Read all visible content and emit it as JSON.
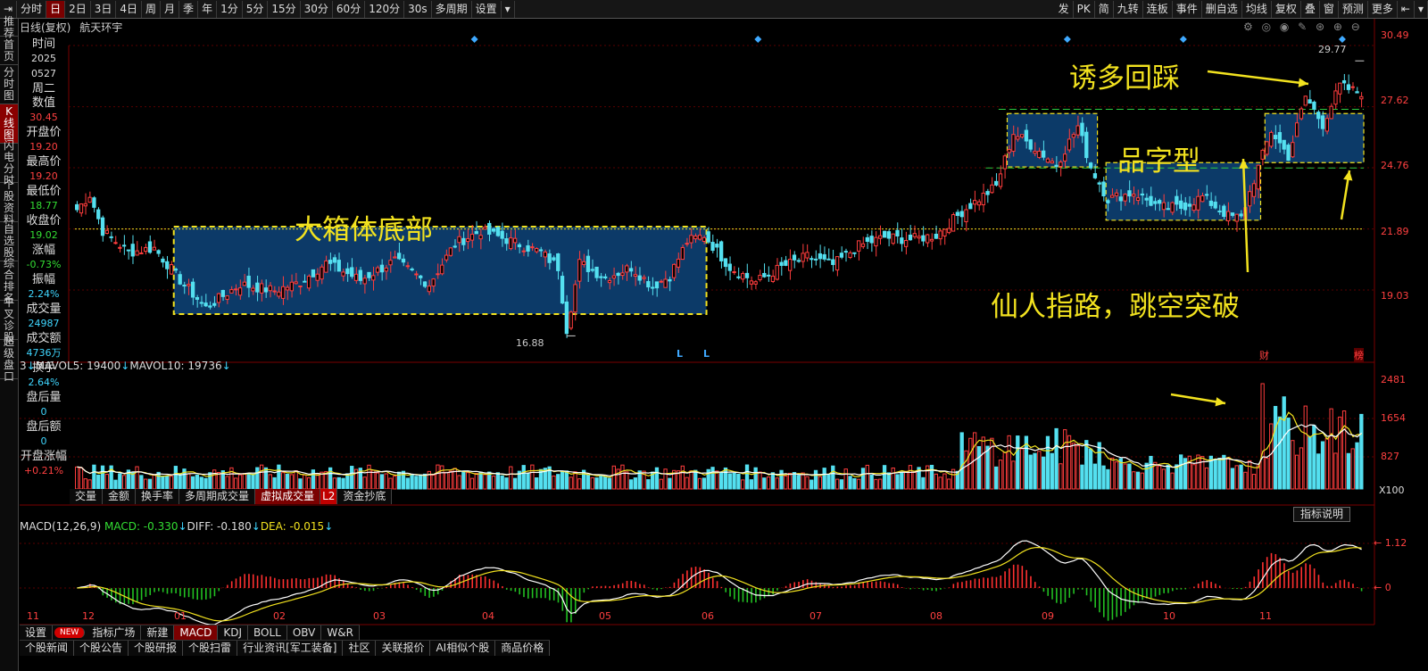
{
  "toolbar": {
    "items": [
      "分时",
      "日",
      "2日",
      "3日",
      "4日",
      "周",
      "月",
      "季",
      "年",
      "1分",
      "5分",
      "15分",
      "30分",
      "60分",
      "120分",
      "30s",
      "多周期",
      "设置"
    ],
    "active": "日",
    "right": [
      "发",
      "PK",
      "简",
      "九转",
      "连板",
      "事件",
      "删自选",
      "均线",
      "复权",
      "叠",
      "窗",
      "预测",
      "更多"
    ]
  },
  "sidebar": [
    {
      "label": "推荐",
      "active": false
    },
    {
      "label": "首页",
      "active": false
    },
    {
      "label": "分时图",
      "active": false
    },
    {
      "label": "K线图",
      "active": true
    },
    {
      "label": "闪电分时",
      "active": false
    },
    {
      "label": "个股资料",
      "active": false
    },
    {
      "label": "自选股",
      "active": false
    },
    {
      "label": "综合排名",
      "active": false
    },
    {
      "label": "牛叉诊股",
      "active": false
    },
    {
      "label": "超级盘口",
      "active": false
    }
  ],
  "stock": {
    "period_label": "日线(复权)",
    "name": "航天环宇"
  },
  "info": [
    {
      "label": "时间",
      "value": "2025",
      "color": "wht"
    },
    {
      "label": "",
      "value": "0527",
      "color": "wht"
    },
    {
      "label": "周二",
      "value": "",
      "color": "wht"
    },
    {
      "label": "数值",
      "value": "30.45",
      "color": "red"
    },
    {
      "label": "开盘价",
      "value": "19.20",
      "color": "red"
    },
    {
      "label": "最高价",
      "value": "19.20",
      "color": "red"
    },
    {
      "label": "最低价",
      "value": "18.77",
      "color": "grn"
    },
    {
      "label": "收盘价",
      "value": "19.02",
      "color": "grn"
    },
    {
      "label": "涨幅",
      "value": "-0.73%",
      "color": "grn"
    },
    {
      "label": "振幅",
      "value": "2.24%",
      "color": "cyan"
    },
    {
      "label": "成交量",
      "value": "24987",
      "color": "cyan"
    },
    {
      "label": "成交额",
      "value": "4736万",
      "color": "cyan"
    },
    {
      "label": "换手",
      "value": "2.64%",
      "color": "cyan"
    },
    {
      "label": "盘后量",
      "value": "0",
      "color": "cyan"
    },
    {
      "label": "盘后额",
      "value": "0",
      "color": "cyan"
    },
    {
      "label": "开盘涨幅",
      "value": "+0.21%",
      "color": "red"
    }
  ],
  "price_axis": {
    "ticks": [
      "30.49",
      "27.62",
      "24.76",
      "21.89",
      "19.03"
    ]
  },
  "max_label": "29.77",
  "min_label": "16.88",
  "markers": {
    "L1": "L",
    "L2": "L",
    "cai": "财",
    "bang": "榜"
  },
  "vol_legend": {
    "mavol5": "MAVOL5: 19400",
    "mavol10": "MAVOL10: 19736",
    "prefix": "3"
  },
  "vol_axis": {
    "ticks": [
      "2481",
      "1654",
      "827"
    ],
    "unit": "X100"
  },
  "vol_tabs": [
    "交量",
    "金额",
    "换手率",
    "多周期成交量",
    "虚拟成交量",
    "L2",
    "资金抄底"
  ],
  "vol_tab_active": "虚拟成交量",
  "macd_legend": {
    "name": "MACD(12,26,9)",
    "macd": "MACD: -0.330",
    "diff": "DIFF: -0.180",
    "dea": "DEA: -0.015"
  },
  "macd_axis": {
    "ticks": [
      "1.12",
      "0"
    ]
  },
  "explain_btn": "指标说明",
  "x_months": [
    "11",
    "12",
    "01",
    "02",
    "03",
    "04",
    "05",
    "06",
    "07",
    "08",
    "09",
    "10",
    "11"
  ],
  "ind_tabs": [
    "设置",
    "NEW",
    "指标广场",
    "新建",
    "MACD",
    "KDJ",
    "BOLL",
    "OBV",
    "W&R"
  ],
  "ind_tab_active": "MACD",
  "news_tabs": [
    "个股新闻",
    "个股公告",
    "个股研报",
    "个股扫雷",
    "行业资讯[军工装备]",
    "社区",
    "关联报价",
    "AI相似个股",
    "商品价格"
  ],
  "annotations": {
    "box_big": "大箱体底部",
    "pin": "品字型",
    "lure": "诱多回踩",
    "gap": "仙人指路，跳空突破"
  },
  "colors": {
    "up": "#ff3d3d",
    "down": "#54e0f0",
    "box_fill": "#0c3a68",
    "annotation": "#f2e21f",
    "background": "#000000"
  },
  "chart_data": {
    "type": "candlestick",
    "title": "航天环宇 日线(复权)",
    "ylim": [
      16.5,
      30.49
    ],
    "anchors": [
      [
        0,
        22.8
      ],
      [
        3,
        23.5
      ],
      [
        6,
        21.8
      ],
      [
        12,
        20.8
      ],
      [
        18,
        21.0
      ],
      [
        24,
        19.5
      ],
      [
        30,
        18.2
      ],
      [
        38,
        19.3
      ],
      [
        46,
        19.0
      ],
      [
        52,
        19.4
      ],
      [
        58,
        20.3
      ],
      [
        66,
        19.5
      ],
      [
        74,
        20.4
      ],
      [
        82,
        19.3
      ],
      [
        88,
        21.2
      ],
      [
        94,
        21.8
      ],
      [
        100,
        21.4
      ],
      [
        108,
        20.8
      ],
      [
        112,
        20.1
      ],
      [
        114,
        17.2
      ],
      [
        117,
        20.3
      ],
      [
        123,
        19.6
      ],
      [
        129,
        20.1
      ],
      [
        134,
        19.2
      ],
      [
        138,
        19.7
      ],
      [
        142,
        21.3
      ],
      [
        146,
        21.6
      ],
      [
        152,
        20.1
      ],
      [
        158,
        19.4
      ],
      [
        164,
        20.1
      ],
      [
        170,
        20.6
      ],
      [
        176,
        20.2
      ],
      [
        182,
        21.1
      ],
      [
        188,
        21.5
      ],
      [
        194,
        21.4
      ],
      [
        200,
        21.6
      ],
      [
        206,
        22.7
      ],
      [
        214,
        23.9
      ],
      [
        218,
        26.4
      ],
      [
        223,
        25.7
      ],
      [
        228,
        24.9
      ],
      [
        233,
        26.7
      ],
      [
        236,
        24.8
      ],
      [
        240,
        23.3
      ],
      [
        246,
        23.6
      ],
      [
        252,
        22.9
      ],
      [
        257,
        22.9
      ],
      [
        262,
        23.4
      ],
      [
        268,
        22.5
      ],
      [
        271,
        22.4
      ],
      [
        274,
        24.2
      ],
      [
        278,
        26.5
      ],
      [
        282,
        25.3
      ],
      [
        286,
        28.1
      ],
      [
        290,
        26.8
      ],
      [
        294,
        28.6
      ],
      [
        298,
        28.3
      ]
    ],
    "y_ticks": [
      30.49,
      27.62,
      24.76,
      21.89,
      19.03
    ],
    "max_price": 29.77,
    "min_price": 16.88,
    "volume_ticks": [
      2481,
      1654,
      827
    ],
    "macd_ticks": [
      1.12,
      0
    ],
    "x_labels": [
      "11",
      "12",
      "01",
      "02",
      "03",
      "04",
      "05",
      "06",
      "07",
      "08",
      "09",
      "10",
      "11"
    ]
  }
}
